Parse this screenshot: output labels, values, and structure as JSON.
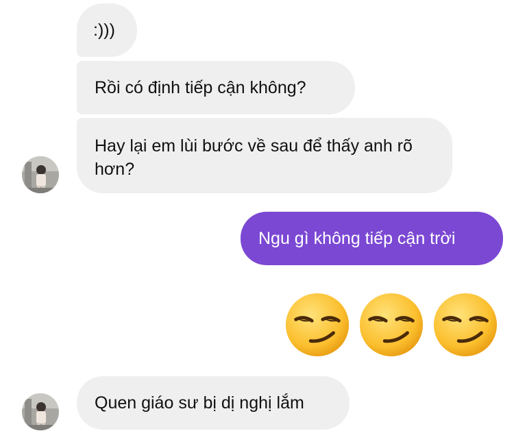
{
  "messages": [
    {
      "sender": "them",
      "text": ":)))"
    },
    {
      "sender": "them",
      "text": "Rồi có định tiếp cận không?"
    },
    {
      "sender": "them",
      "text": "Hay lại em lùi bước về sau để thấy anh rõ hơn?"
    },
    {
      "sender": "me",
      "text": "Ngu gì không tiếp cận trời"
    },
    {
      "sender": "me",
      "emoji": "smirking-face",
      "count": 3
    },
    {
      "sender": "them",
      "text": "Quen giáo sư bị dị nghị lắm"
    }
  ],
  "colors": {
    "incoming_bubble": "#efeff0",
    "outgoing_bubble": "#7b48d3",
    "outgoing_text": "#ffffff",
    "incoming_text": "#101010"
  },
  "icons": {
    "avatar": "contact-avatar-photo",
    "emoji": "smirking-face-emoji"
  }
}
